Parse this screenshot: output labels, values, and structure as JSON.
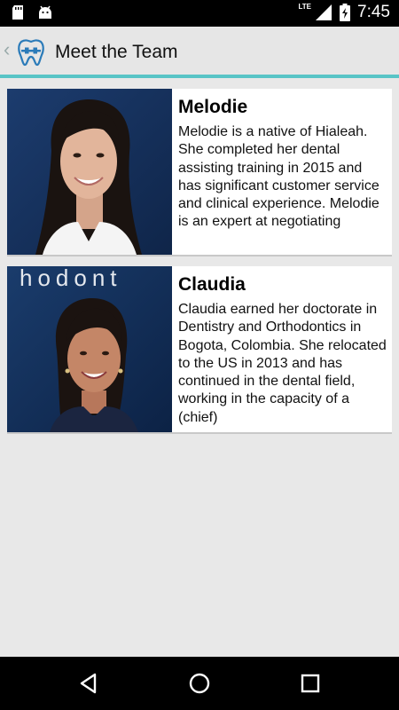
{
  "status_bar": {
    "time": "7:45",
    "network": "LTE",
    "icons": [
      "sd-card-icon",
      "android-icon",
      "signal-icon",
      "battery-icon"
    ]
  },
  "app_bar": {
    "title": "Meet the Team",
    "icons": [
      "back-chevron-icon",
      "tooth-logo-icon"
    ]
  },
  "team": [
    {
      "name": "Melodie",
      "bio": "Melodie is a native of Hialeah. She completed her dental assisting training in 2015 and has significant customer service and clinical experience. Melodie is an expert at negotiating"
    },
    {
      "name": "Claudia",
      "bio": "Claudia earned her doctorate in Dentistry and Orthodontics in Bogota, Colombia. She relocated to the US in 2013 and has continued in the dental field, working in the capacity of a (chief)",
      "photo_backdrop_text": "hodont"
    }
  ],
  "nav_bar": {
    "buttons": [
      "back-nav-icon",
      "home-nav-icon",
      "recents-nav-icon"
    ]
  },
  "colors": {
    "accent": "#58c4c6",
    "app_bar_bg": "#e6e6e6",
    "content_bg": "#e8e8e8",
    "photo_bg_dark_blue": "#14305a"
  }
}
